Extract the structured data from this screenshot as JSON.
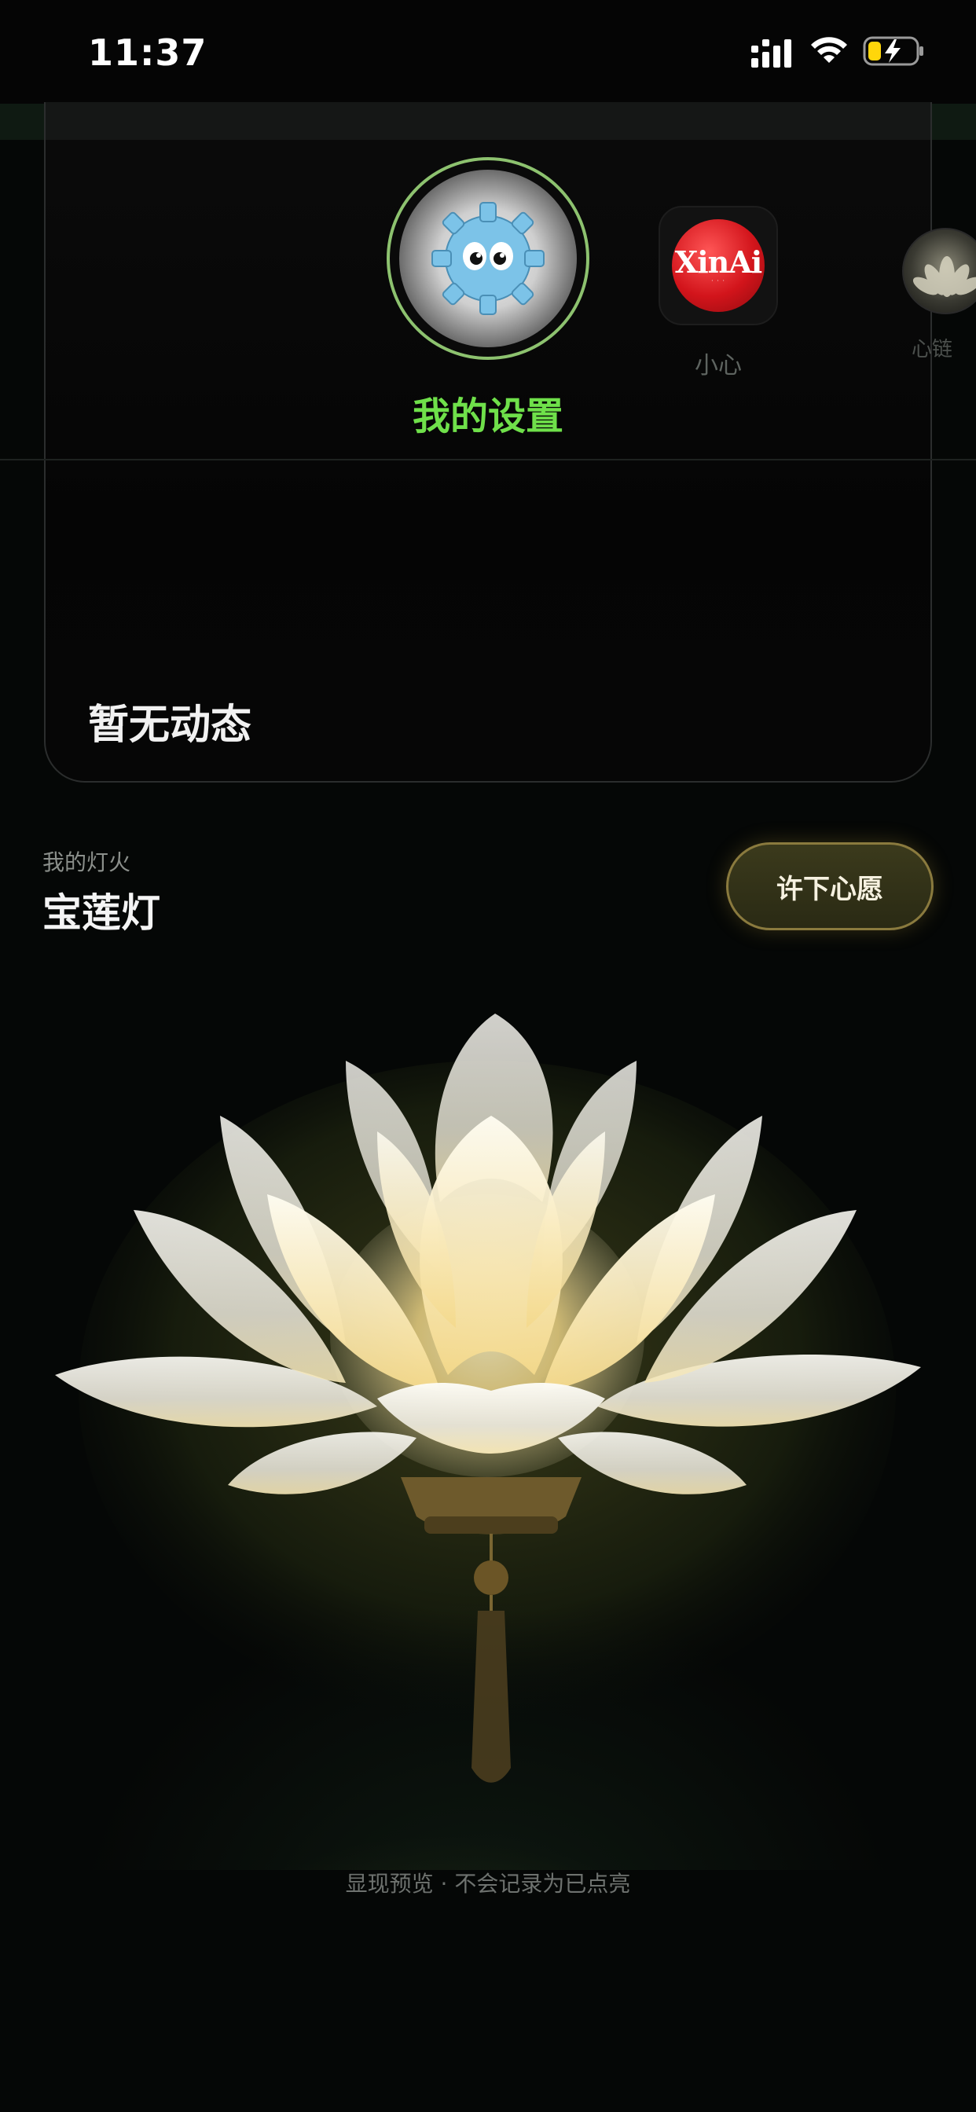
{
  "status_bar": {
    "time": "11:37"
  },
  "profiles": [
    {
      "label": "我的设置",
      "selected": true,
      "icon": "gear-mascot-icon"
    },
    {
      "label": "小心",
      "selected": false,
      "icon": "xinai-logo",
      "logo_text": "XinAi"
    },
    {
      "label": "心链",
      "selected": false,
      "icon": "lotus-icon"
    }
  ],
  "feed": {
    "empty_text": "暂无动态"
  },
  "lamp": {
    "caption": "我的灯火",
    "name": "宝莲灯",
    "wish_button": "许下心愿"
  },
  "footer_note": "显现预览 · 不会记录为已点亮",
  "colors": {
    "accent_green": "#6fe04a",
    "ring_green": "#8dc26f",
    "wish_border": "#8a7a3e"
  }
}
